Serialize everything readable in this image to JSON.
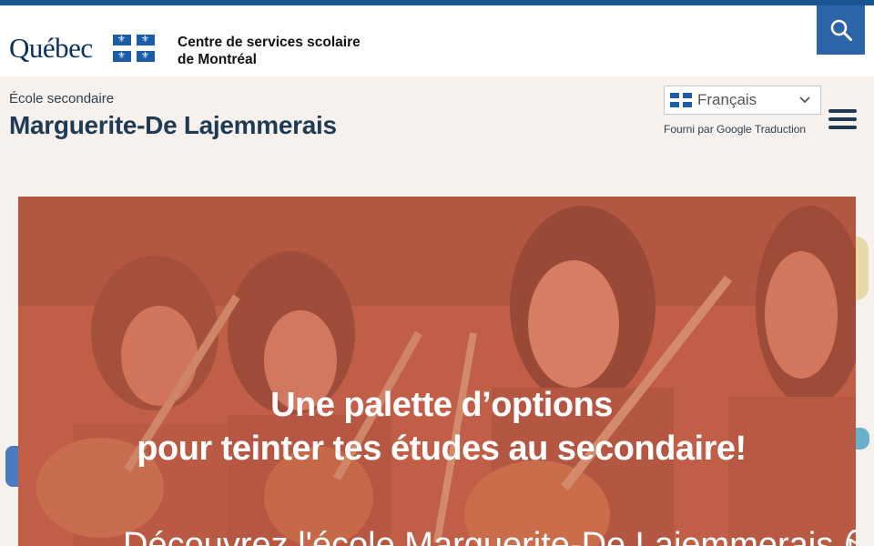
{
  "header": {
    "logo_text": "Québec",
    "org_line1": "Centre de services scolaire",
    "org_line2": "de Montréal",
    "search_icon": "search-icon"
  },
  "school": {
    "type": "École secondaire",
    "name": "Marguerite-De Lajemmerais"
  },
  "translate": {
    "selected_language": "Français",
    "powered_by": "Fourni par Google Traduction"
  },
  "menu_icon": "hamburger-menu-icon",
  "hero": {
    "title_line1": "Une palette d’options",
    "title_line2": "pour teinter tes études au secondaire!",
    "cta_text": "Découvrez l'école Marguerite-De Lajemmerais",
    "cta_icon": "play-circle-icon"
  },
  "colors": {
    "topbar": "#1a5590",
    "search_button": "#2d63a7",
    "page_background": "#f6f1ec",
    "heading": "#1e3a55",
    "hero_overlay": "#c8624a"
  }
}
